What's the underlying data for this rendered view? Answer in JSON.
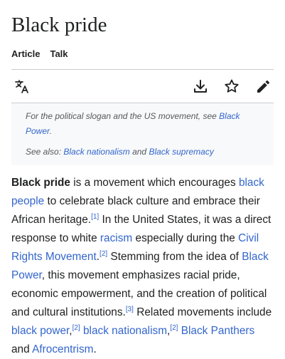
{
  "page": {
    "title": "Black pride",
    "tabs": {
      "article": "Article",
      "talk": "Talk"
    }
  },
  "toolbar": {
    "language_icon": "language-translate-icon",
    "download_icon": "download-icon",
    "watch_icon": "star-icon",
    "edit_icon": "pencil-edit-icon"
  },
  "hatnote": {
    "line1_prefix": "For the political slogan and the US movement, see ",
    "line1_link": "Black Power",
    "line1_suffix": ".",
    "line2_prefix": "See also: ",
    "line2_link1": "Black nationalism",
    "line2_and": " and ",
    "line2_link2": "Black supremacy"
  },
  "body": {
    "term": "Black pride",
    "t1": " is a movement which encourages ",
    "l_black_people": "black people",
    "t2": " to celebrate black culture and embrace their African heritage.",
    "ref1": "[1]",
    "t3": " In the United States, it was a direct response to white ",
    "l_racism": "racism",
    "t4": " especially during the ",
    "l_civil_rights": "Civil Rights Movement",
    "t5": ".",
    "ref2a": "[2]",
    "t6": " Stemming from the idea of ",
    "l_black_power": "Black Power",
    "t7": ", this movement emphasizes racial pride, economic empowerment, and the creation of political and cultural institutions.",
    "ref3": "[3]",
    "t8": " Related movements include ",
    "l_black_power_lc": "black power",
    "t9": ",",
    "ref2b": "[2]",
    "t10": " ",
    "l_black_nationalism": "black nationalism",
    "t11": ",",
    "ref2c": "[2]",
    "t12": " ",
    "l_black_panthers": "Black Panthers",
    "t13": " and ",
    "l_afrocentrism": "Afrocentrism",
    "t14": "."
  },
  "colors": {
    "link": "#3366cc",
    "text": "#202122",
    "hatnote_bg": "#f8f9fa",
    "rule": "#c8ccd1"
  }
}
